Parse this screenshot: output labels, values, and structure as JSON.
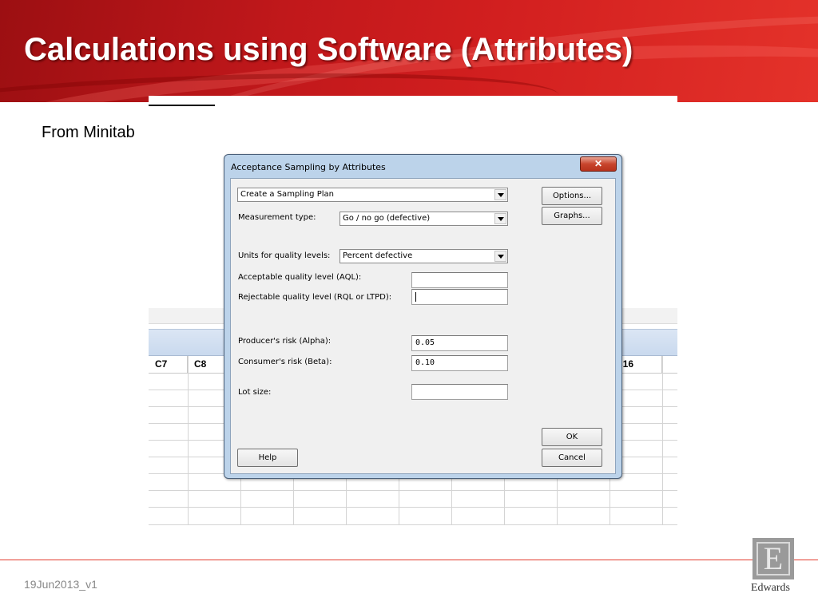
{
  "slide": {
    "title": "Calculations using Software (Attributes)",
    "subtitle": "From Minitab",
    "version": "19Jun2013_v1",
    "logo_text": "Edwards",
    "logo_glyph": "E",
    "accent_color": "#d21f1f"
  },
  "worksheet": {
    "columns": [
      "C7",
      "C8",
      "",
      "",
      "",
      "",
      "",
      "",
      "",
      "C16",
      ""
    ]
  },
  "dialog": {
    "title": "Acceptance Sampling by Attributes",
    "close_glyph": "✕",
    "plan_select": "Create a Sampling Plan",
    "measurement_type_label": "Measurement type:",
    "measurement_type_value": "Go / no go (defective)",
    "units_label": "Units for quality levels:",
    "units_value": "Percent defective",
    "aql_label": "Acceptable quality level (AQL):",
    "aql_value": "",
    "rql_label": "Rejectable quality level (RQL or LTPD):",
    "rql_value": "",
    "alpha_label": "Producer's risk (Alpha):",
    "alpha_value": "0.05",
    "beta_label": "Consumer's risk (Beta):",
    "beta_value": "0.10",
    "lot_label": "Lot size:",
    "lot_value": "",
    "options_button": "Options...",
    "graphs_button": "Graphs...",
    "help_button": "Help",
    "ok_button": "OK",
    "cancel_button": "Cancel"
  }
}
